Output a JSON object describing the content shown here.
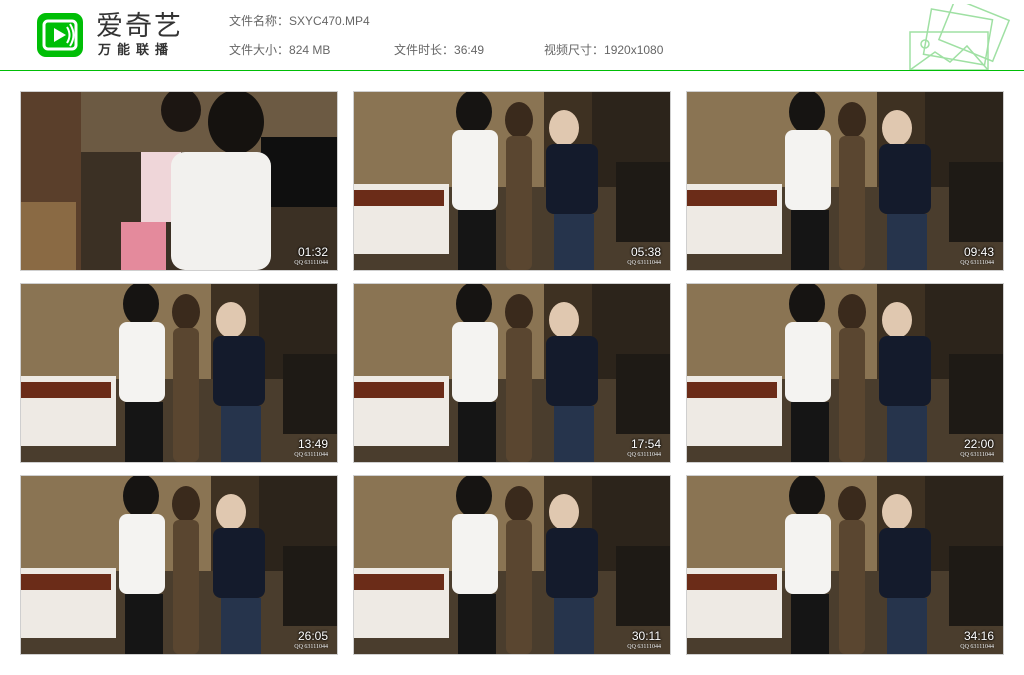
{
  "brand": {
    "title": "爱奇艺",
    "subtitle": "万能联播"
  },
  "meta": {
    "file_name_label": "文件名称：",
    "file_name": "SXYC470.MP4",
    "file_size_label": "文件大小：",
    "file_size": "824 MB",
    "duration_label": "文件时长：",
    "duration": "36:49",
    "resolution_label": "视频尺寸：",
    "resolution": "1920x1080"
  },
  "colors": {
    "accent": "#00be06",
    "header_line": "#00be06"
  },
  "thumbnails": [
    {
      "time": "01:32",
      "watermark": "QQ 63111044",
      "scene": "closeup"
    },
    {
      "time": "05:38",
      "watermark": "QQ 63111044",
      "scene": "room"
    },
    {
      "time": "09:43",
      "watermark": "QQ 63111044",
      "scene": "room"
    },
    {
      "time": "13:49",
      "watermark": "QQ 63111044",
      "scene": "room"
    },
    {
      "time": "17:54",
      "watermark": "QQ 63111044",
      "scene": "room"
    },
    {
      "time": "22:00",
      "watermark": "QQ 63111044",
      "scene": "room"
    },
    {
      "time": "26:05",
      "watermark": "QQ 63111044",
      "scene": "room"
    },
    {
      "time": "30:11",
      "watermark": "QQ 63111044",
      "scene": "room"
    },
    {
      "time": "34:16",
      "watermark": "QQ 63111044",
      "scene": "room"
    }
  ]
}
